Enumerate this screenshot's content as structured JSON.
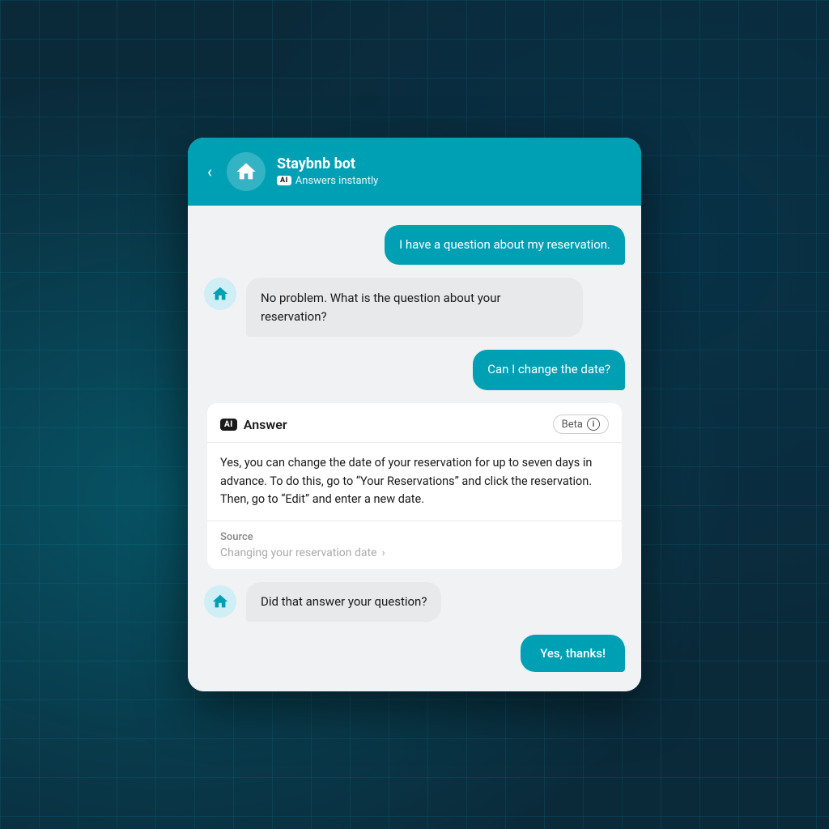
{
  "background": {
    "color": "#0a2a3a"
  },
  "header": {
    "back_label": "‹",
    "bot_name": "Staybnb bot",
    "ai_badge": "AI",
    "status_text": "Answers instantly",
    "accent_color": "#00a0b4"
  },
  "messages": [
    {
      "id": "msg1",
      "type": "user",
      "text": "I have a question about my reservation."
    },
    {
      "id": "msg2",
      "type": "bot",
      "text": "No problem. What is the question about your reservation?"
    },
    {
      "id": "msg3",
      "type": "user",
      "text": "Can I change the date?"
    },
    {
      "id": "msg4",
      "type": "answer_card",
      "ai_badge": "AI",
      "title": "Answer",
      "beta_label": "Beta",
      "body": "Yes, you can change the date of your reservation for up to seven days in advance. To do this, go to “Your Reservations” and click the reservation. Then, go to “Edit” and enter a new date.",
      "source_label": "Source",
      "source_link_text": "Changing your reservation date",
      "source_chevron": "›"
    },
    {
      "id": "msg5",
      "type": "bot",
      "text": "Did that answer your question?"
    },
    {
      "id": "msg6",
      "type": "user",
      "text": "Yes, thanks!"
    }
  ]
}
